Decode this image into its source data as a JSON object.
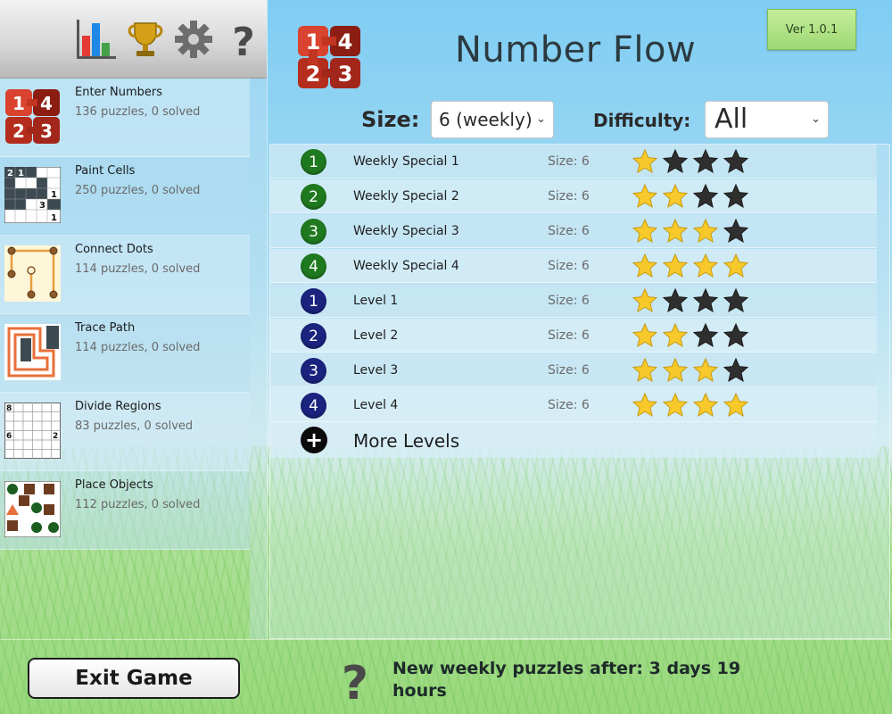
{
  "app": {
    "title": "Number Flow",
    "version_label": "Ver 1.0.1"
  },
  "toolbar": {
    "icons": [
      "bar-chart-icon",
      "trophy-icon",
      "gear-icon",
      "help-icon"
    ]
  },
  "puzzle_types": [
    {
      "name": "Enter Numbers",
      "subtitle": "136 puzzles, 0 solved",
      "icon": "enter-numbers-icon"
    },
    {
      "name": "Paint Cells",
      "subtitle": "250 puzzles, 0 solved",
      "icon": "paint-cells-icon"
    },
    {
      "name": "Connect Dots",
      "subtitle": "114 puzzles, 0 solved",
      "icon": "connect-dots-icon"
    },
    {
      "name": "Trace Path",
      "subtitle": "114 puzzles, 0 solved",
      "icon": "trace-path-icon"
    },
    {
      "name": "Divide Regions",
      "subtitle": "83 puzzles, 0 solved",
      "icon": "divide-regions-icon"
    },
    {
      "name": "Place Objects",
      "subtitle": "112 puzzles, 0 solved",
      "icon": "place-objects-icon"
    }
  ],
  "filters": {
    "size_label": "Size:",
    "size_value": "6 (weekly)",
    "difficulty_label": "Difficulty:",
    "difficulty_value": "All"
  },
  "levels": [
    {
      "number": "1",
      "name": "Weekly Special 1",
      "size": "Size: 6",
      "stars": 1,
      "color": "#1f7a1f"
    },
    {
      "number": "2",
      "name": "Weekly Special 2",
      "size": "Size: 6",
      "stars": 2,
      "color": "#1f7a1f"
    },
    {
      "number": "3",
      "name": "Weekly Special 3",
      "size": "Size: 6",
      "stars": 3,
      "color": "#1f7a1f"
    },
    {
      "number": "4",
      "name": "Weekly Special 4",
      "size": "Size: 6",
      "stars": 4,
      "color": "#1f7a1f"
    },
    {
      "number": "1",
      "name": "Level 1",
      "size": "Size: 6",
      "stars": 1,
      "color": "#1a237e"
    },
    {
      "number": "2",
      "name": "Level 2",
      "size": "Size: 6",
      "stars": 2,
      "color": "#1a237e"
    },
    {
      "number": "3",
      "name": "Level 3",
      "size": "Size: 6",
      "stars": 3,
      "color": "#1a237e"
    },
    {
      "number": "4",
      "name": "Level 4",
      "size": "Size: 6",
      "stars": 4,
      "color": "#1a237e"
    }
  ],
  "max_stars": 4,
  "more_levels_label": "More Levels",
  "footer": {
    "exit_label": "Exit Game",
    "message": "New weekly puzzles after: 3 days 19 hours"
  },
  "colors": {
    "star_gold": "#f7c92a",
    "star_dark": "#2f2f2f",
    "logo_red": "#c0392b"
  }
}
